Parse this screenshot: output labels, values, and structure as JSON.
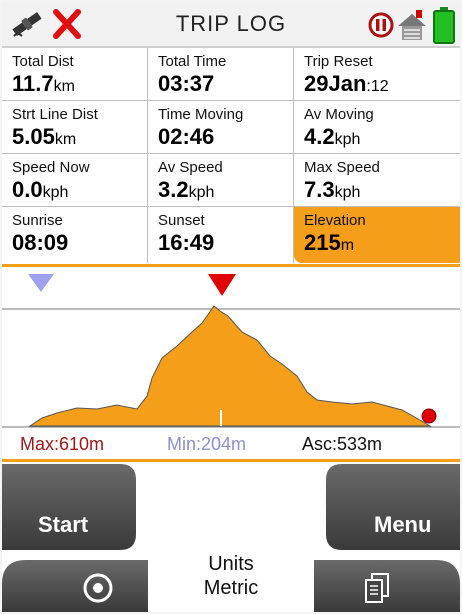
{
  "header": {
    "title": "TRIP LOG",
    "icons": [
      "satellite-icon",
      "close-icon",
      "pause-icon",
      "home-icon",
      "battery-icon"
    ]
  },
  "fields": [
    {
      "label": "Total Dist",
      "value": "11.7",
      "unit": "km"
    },
    {
      "label": "Total Time",
      "value": "03:37",
      "unit": ""
    },
    {
      "label": "Trip Reset",
      "value": "29Jan",
      "unit": ":12"
    },
    {
      "label": "Strt Line Dist",
      "value": "5.05",
      "unit": "km"
    },
    {
      "label": "Time Moving",
      "value": "02:46",
      "unit": ""
    },
    {
      "label": "Av Moving",
      "value": "4.2",
      "unit": "kph"
    },
    {
      "label": "Speed Now",
      "value": "0.0",
      "unit": "kph"
    },
    {
      "label": "Av Speed",
      "value": "3.2",
      "unit": "kph"
    },
    {
      "label": "Max Speed",
      "value": "7.3",
      "unit": "kph"
    },
    {
      "label": "Sunrise",
      "value": "08:09",
      "unit": ""
    },
    {
      "label": "Sunset",
      "value": "16:49",
      "unit": ""
    },
    {
      "label": "Elevation",
      "value": "215",
      "unit": "m"
    }
  ],
  "profile_stats": {
    "max_label": "Max:",
    "max_value": "610m",
    "min_label": "Min:",
    "min_value": "204m",
    "asc_label": "Asc:",
    "asc_value": "533m"
  },
  "colors": {
    "accent": "#f49e19",
    "max_color": "#a01818",
    "min_color": "#8f8fcf",
    "marker_red": "#e00000",
    "marker_blue": "#a0a0f0",
    "button": "#555555"
  },
  "controls": {
    "start_label": "Start",
    "menu_label": "Menu",
    "units_title": "Units",
    "units_value": "Metric"
  }
}
